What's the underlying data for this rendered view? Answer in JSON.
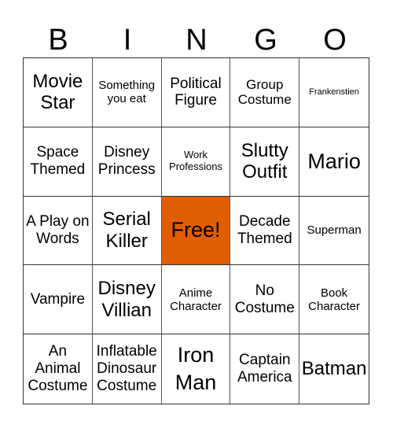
{
  "header": {
    "letters": [
      "B",
      "I",
      "N",
      "G",
      "O"
    ]
  },
  "colors": {
    "free_cell": "#e05e00"
  },
  "cells": [
    {
      "text": "Movie Star",
      "size": "s-lg"
    },
    {
      "text": "Something you eat",
      "size": "s-xs"
    },
    {
      "text": "Political Figure",
      "size": "s-md"
    },
    {
      "text": "Group Costume",
      "size": "s-sm"
    },
    {
      "text": "Frankenstien",
      "size": "s-tiny"
    },
    {
      "text": "Space Themed",
      "size": "s-md"
    },
    {
      "text": "Disney Princess",
      "size": "s-md"
    },
    {
      "text": "Work Professions",
      "size": "s-xxs"
    },
    {
      "text": "Slutty Outfit",
      "size": "s-lg"
    },
    {
      "text": "Mario",
      "size": "s-xl"
    },
    {
      "text": "A Play on Words",
      "size": "s-md"
    },
    {
      "text": "Serial Killer",
      "size": "s-lg"
    },
    {
      "text": "Free!",
      "size": "s-xl",
      "free": true
    },
    {
      "text": "Decade Themed",
      "size": "s-md"
    },
    {
      "text": "Superman",
      "size": "s-xs"
    },
    {
      "text": "Vampire",
      "size": "s-md"
    },
    {
      "text": "Disney Villian",
      "size": "s-lg"
    },
    {
      "text": "Anime Character",
      "size": "s-xs"
    },
    {
      "text": "No Costume",
      "size": "s-md"
    },
    {
      "text": "Book Character",
      "size": "s-xs"
    },
    {
      "text": "An Animal Costume",
      "size": "s-md"
    },
    {
      "text": "Inflatable Dinosaur Costume",
      "size": "s-md"
    },
    {
      "text": "Iron Man",
      "size": "s-xl"
    },
    {
      "text": "Captain America",
      "size": "s-md"
    },
    {
      "text": "Batman",
      "size": "s-lg"
    }
  ]
}
